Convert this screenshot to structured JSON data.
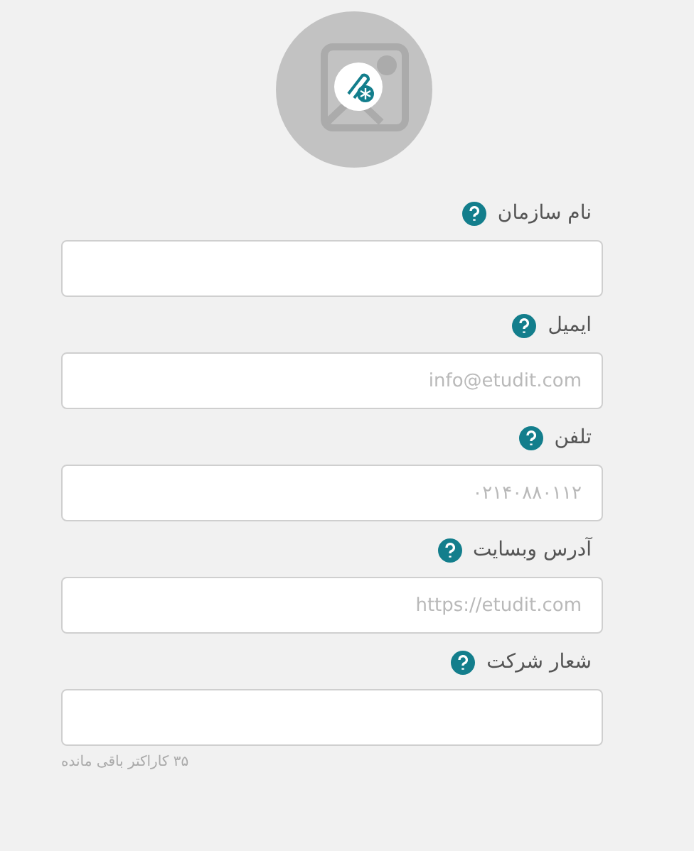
{
  "fields": [
    {
      "label": "نام سازمان"
    },
    {
      "label": "ایمیل",
      "placeholder": "info@etudit.com"
    },
    {
      "label": "تلفن",
      "placeholder": "۰۲۱۴۰۸۸۰۱۱۲"
    },
    {
      "label": "آدرس وبسایت",
      "placeholder": "https://etudit.com"
    },
    {
      "label": "شعار شرکت",
      "hint": "۳۵ کاراکتر باقی مانده"
    }
  ]
}
